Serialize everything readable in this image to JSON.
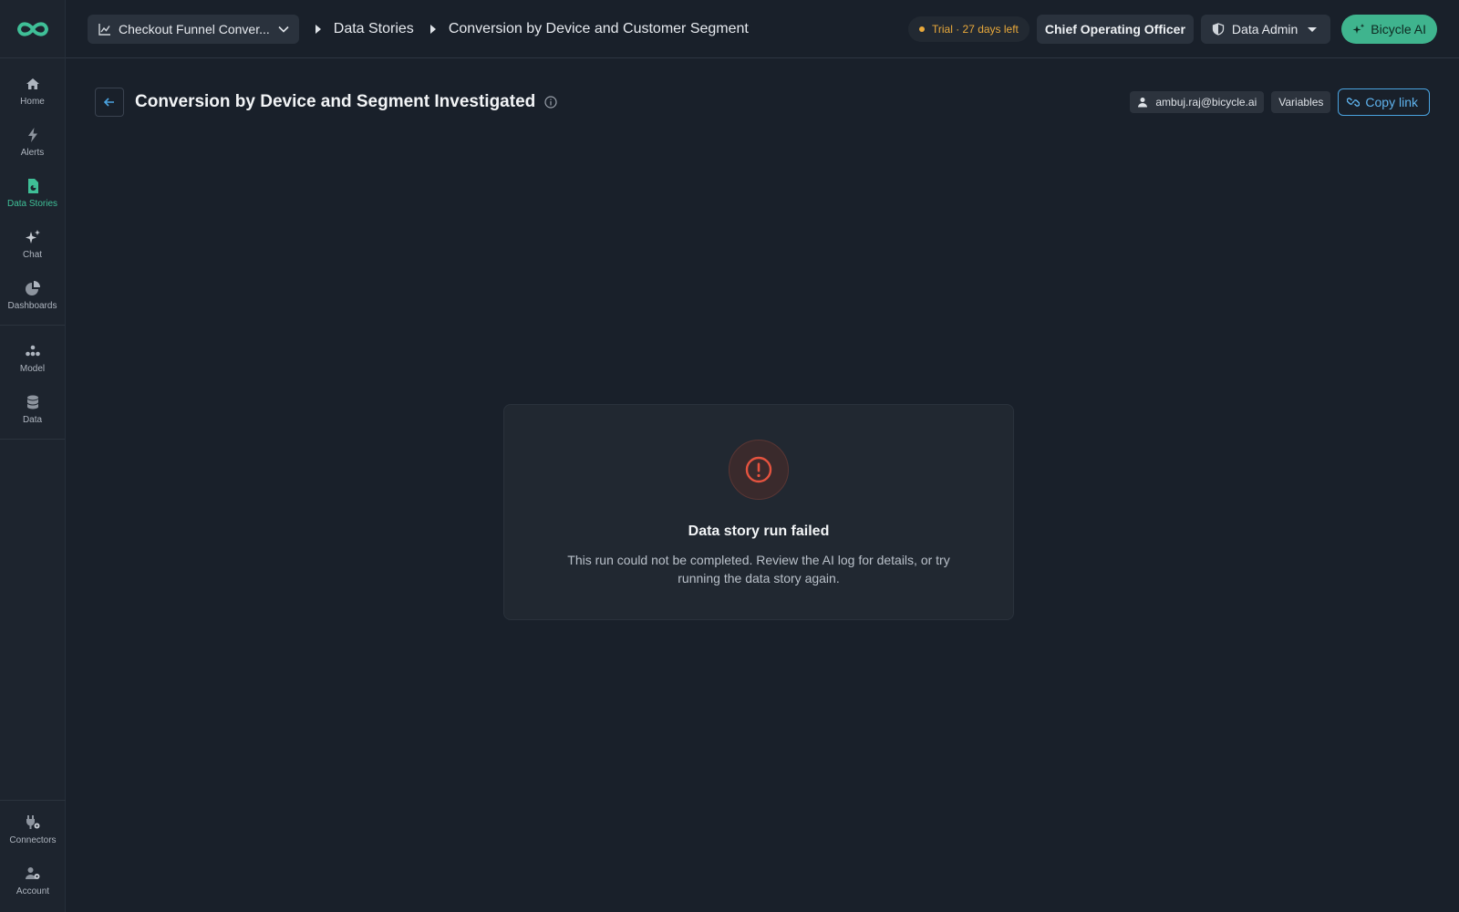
{
  "sidebar": {
    "items": [
      {
        "label": "Home",
        "icon": "home-icon"
      },
      {
        "label": "Alerts",
        "icon": "bolt-icon"
      },
      {
        "label": "Data Stories",
        "icon": "document-chart-icon"
      },
      {
        "label": "Chat",
        "icon": "sparkle-icon"
      },
      {
        "label": "Dashboards",
        "icon": "pie-icon"
      },
      {
        "label": "Model",
        "icon": "hierarchy-icon"
      },
      {
        "label": "Data",
        "icon": "database-icon"
      }
    ],
    "bottom_items": [
      {
        "label": "Connectors",
        "icon": "plug-icon"
      },
      {
        "label": "Account",
        "icon": "user-gear-icon"
      }
    ],
    "active": "Data Stories",
    "accent_color": "#3fbf97"
  },
  "topbar": {
    "project": "Checkout Funnel Conver...",
    "breadcrumb": [
      "Data Stories",
      "Conversion by Device and Customer Segment"
    ],
    "trial": "Trial · 27 days left",
    "role": "Chief Operating Officer",
    "admin": "Data Admin",
    "ai_button": "Bicycle AI"
  },
  "header": {
    "title": "Conversion by Device and Segment Investigated",
    "user": "ambuj.raj@bicycle.ai",
    "variables": "Variables",
    "copy_link": "Copy link"
  },
  "error": {
    "title": "Data story run failed",
    "message": "This run could not be completed. Review the AI log for details, or try running the data story again.",
    "color": "#e5533f"
  }
}
